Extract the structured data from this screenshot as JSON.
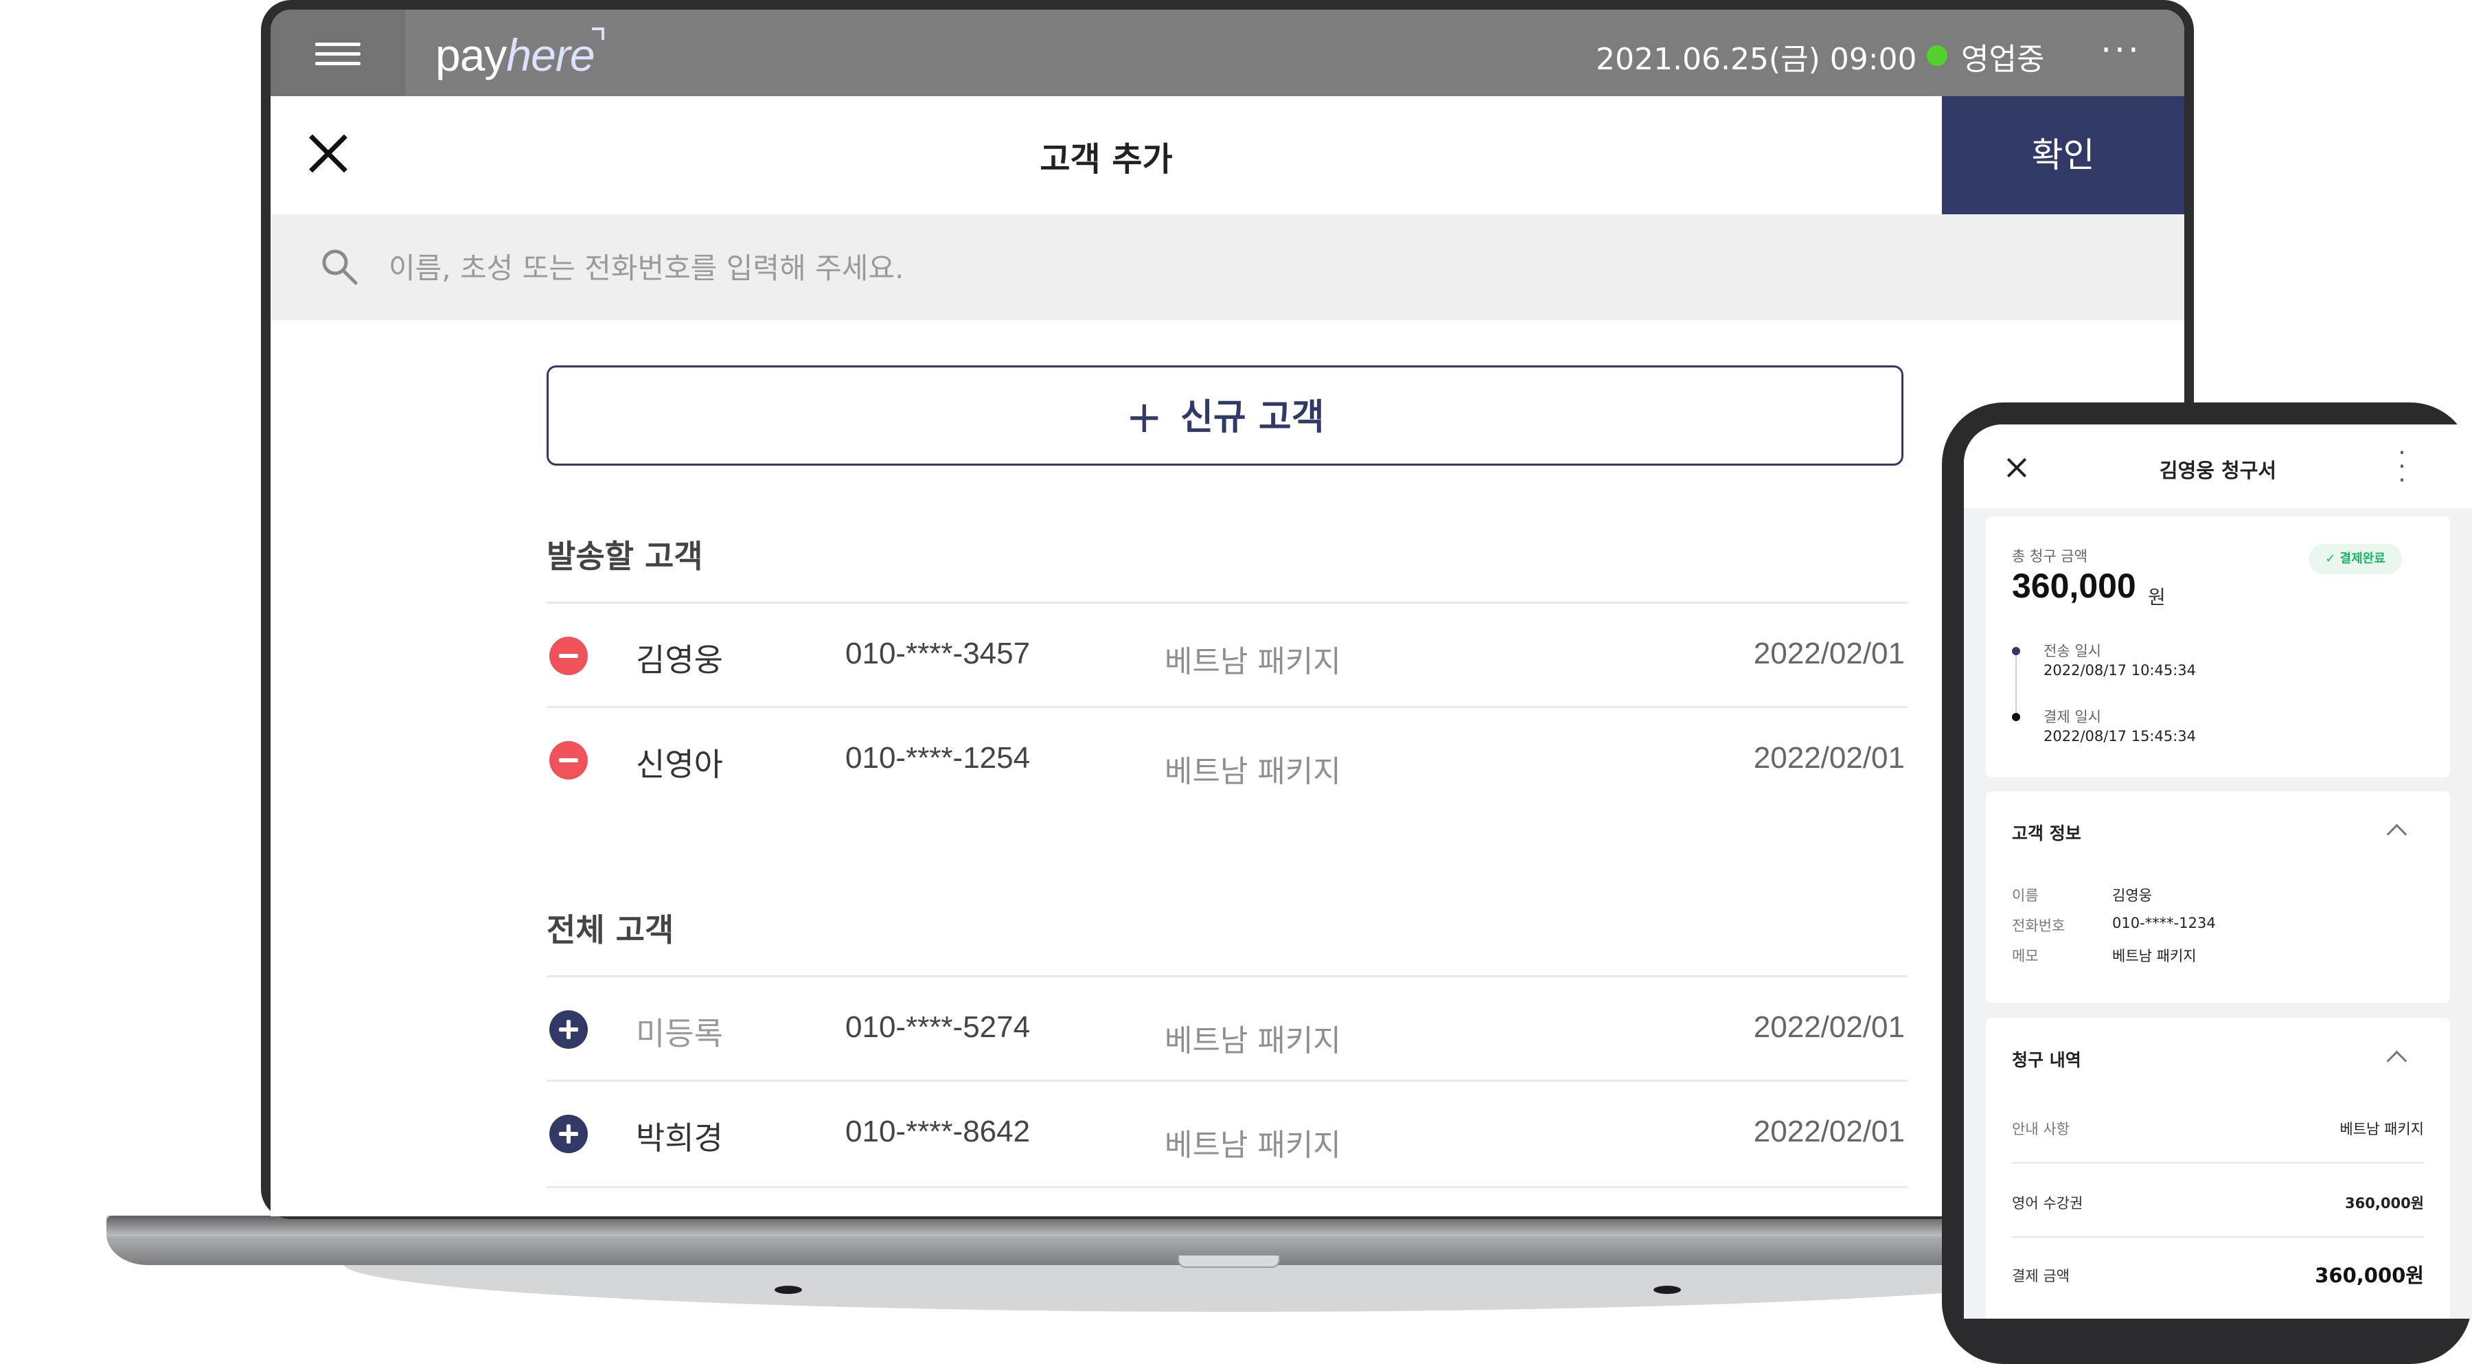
{
  "app": {
    "brand_pay": "pay",
    "brand_here": "here",
    "datetime": "2021.06.25(금) 09:00",
    "status": "영업중",
    "more": "···",
    "status_color": "#52d22b"
  },
  "dialog": {
    "title": "고객 추가",
    "confirm_label": "확인",
    "search_placeholder": "이름, 초성 또는 전화번호를 입력해 주세요.",
    "new_customer_label": "신규 고객",
    "accent_color": "#313a67"
  },
  "send_section": {
    "title": "발송할 고객",
    "rows": [
      {
        "name": "김영웅",
        "phone": "010-****-3457",
        "memo": "베트남 패키지",
        "date": "2022/02/01"
      },
      {
        "name": "신영아",
        "phone": "010-****-1254",
        "memo": "베트남 패키지",
        "date": "2022/02/01"
      }
    ]
  },
  "all_section": {
    "title": "전체 고객",
    "rows": [
      {
        "name": "미등록",
        "phone": "010-****-5274",
        "memo": "베트남 패키지",
        "date": "2022/02/01"
      },
      {
        "name": "박희경",
        "phone": "010-****-8642",
        "memo": "베트남 패키지",
        "date": "2022/02/01"
      }
    ]
  },
  "invoice": {
    "title": "김영웅 청구서",
    "total_label": "총 청구 금액",
    "total_amount": "360,000",
    "total_unit": "원",
    "badge": "결제완료",
    "timeline": [
      {
        "label": "전송 일시",
        "value": "2022/08/17 10:45:34"
      },
      {
        "label": "결제 일시",
        "value": "2022/08/17 15:45:34"
      }
    ],
    "customer_info": {
      "title": "고객 정보",
      "rows": [
        {
          "label": "이름",
          "value": "김영웅"
        },
        {
          "label": "전화번호",
          "value": "010-****-1234"
        },
        {
          "label": "메모",
          "value": "베트남 패키지"
        }
      ]
    },
    "billing": {
      "title": "청구 내역",
      "rows": [
        {
          "label": "안내 사항",
          "value": "베트남 패키지"
        },
        {
          "label": "영어 수강권",
          "value": "360,000원"
        },
        {
          "label": "결제 금액",
          "value": "360,000원"
        }
      ]
    }
  }
}
